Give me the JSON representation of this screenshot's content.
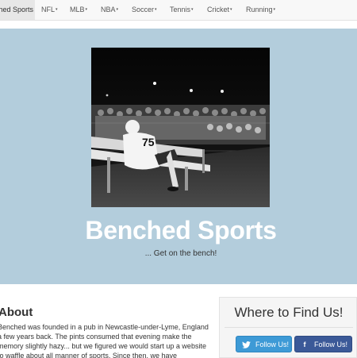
{
  "navbar": {
    "brand": "Benched Sports",
    "items": [
      {
        "label": "NFL"
      },
      {
        "label": "MLB"
      },
      {
        "label": "NBA"
      },
      {
        "label": "Soccer"
      },
      {
        "label": "Tennis"
      },
      {
        "label": "Cricket"
      },
      {
        "label": "Running"
      }
    ],
    "caret": "▾"
  },
  "hero": {
    "title": "Benched Sports",
    "subtitle": "... Get on the bench!",
    "photo": {
      "jersey_number": "75",
      "background_color": "#b3cddc"
    }
  },
  "about": {
    "heading": "About",
    "text": "Benched was founded in a pub in Newcastle-under-Lyme, England a few years back. The pints consumed that evening make the memory slightly hazy... but we figured we would start up a website to waffle about all manner of sports. Since then, we have"
  },
  "find_us": {
    "heading": "Where to Find Us!",
    "twitter": {
      "label": "Follow Us!",
      "icon": "twitter-bird-icon",
      "color": "#3d9ad6"
    },
    "facebook": {
      "label": "Follow Us!",
      "icon": "facebook-f-icon",
      "color": "#3b5998"
    }
  }
}
